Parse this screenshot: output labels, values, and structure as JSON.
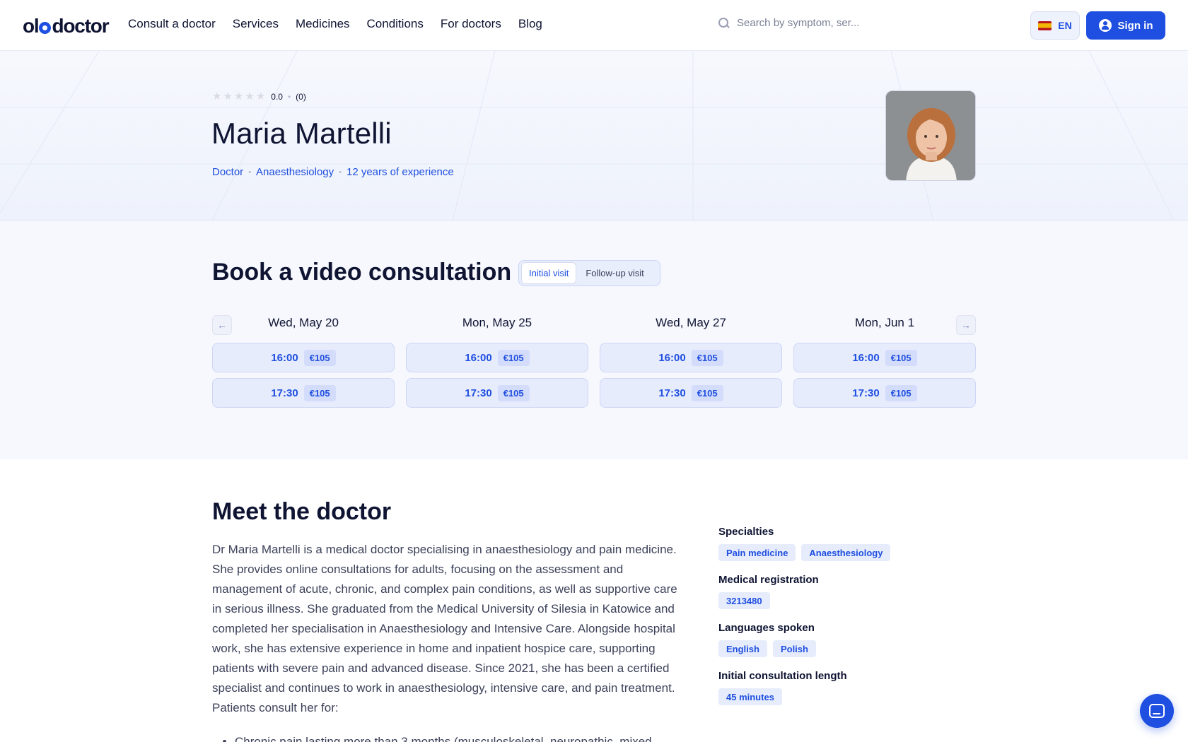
{
  "header": {
    "logo": "oladoctor",
    "nav": [
      "Consult a doctor",
      "Services",
      "Medicines",
      "Conditions",
      "For doctors",
      "Blog"
    ],
    "search_placeholder": "Search by symptom, ser...",
    "lang": "EN",
    "signin": "Sign in"
  },
  "hero": {
    "rating": {
      "stars": 0,
      "value": "0.0",
      "count": "(0)"
    },
    "name": "Maria Martelli",
    "meta": [
      "Doctor",
      "Anaesthesiology",
      "12 years of experience"
    ]
  },
  "booking": {
    "title": "Book a video consultation",
    "toggle": {
      "initial": "Initial visit",
      "followup": "Follow-up visit"
    },
    "days": [
      {
        "label": "Wed, May 20",
        "slots": [
          {
            "time": "16:00",
            "price": "€105"
          },
          {
            "time": "17:30",
            "price": "€105"
          }
        ]
      },
      {
        "label": "Mon, May 25",
        "slots": [
          {
            "time": "16:00",
            "price": "€105"
          },
          {
            "time": "17:30",
            "price": "€105"
          }
        ]
      },
      {
        "label": "Wed, May 27",
        "slots": [
          {
            "time": "16:00",
            "price": "€105"
          },
          {
            "time": "17:30",
            "price": "€105"
          }
        ]
      },
      {
        "label": "Mon, Jun 1",
        "slots": [
          {
            "time": "16:00",
            "price": "€105"
          },
          {
            "time": "17:30",
            "price": "€105"
          }
        ]
      }
    ]
  },
  "meet": {
    "title": "Meet the doctor",
    "bio": "Dr Maria Martelli is a medical doctor specialising in anaesthesiology and pain medicine. She provides online consultations for adults, focusing on the assessment and management of acute, chronic, and complex pain conditions, as well as supportive care in serious illness. She graduated from the Medical University of Silesia in Katowice and completed her specialisation in Anaesthesiology and Intensive Care. Alongside hospital work, she has extensive experience in home and inpatient hospice care, supporting patients with severe pain and advanced disease. Since 2021, she has been a certified specialist and continues to work in anaesthesiology, intensive care, and pain treatment. Patients consult her for:",
    "first_item": "Chronic pain lasting more than 3 months (musculoskeletal, neuropathic, mixed"
  },
  "sidebar": {
    "specialties_label": "Specialties",
    "specialties": [
      "Pain medicine",
      "Anaesthesiology"
    ],
    "registration_label": "Medical registration",
    "registration": "3213480",
    "languages_label": "Languages spoken",
    "languages": [
      "English",
      "Polish"
    ],
    "length_label": "Initial consultation length",
    "length": "45 minutes"
  },
  "colors": {
    "accent": "#1f4fe0",
    "text": "#0f1433",
    "chip_bg": "#e6ecfc"
  }
}
